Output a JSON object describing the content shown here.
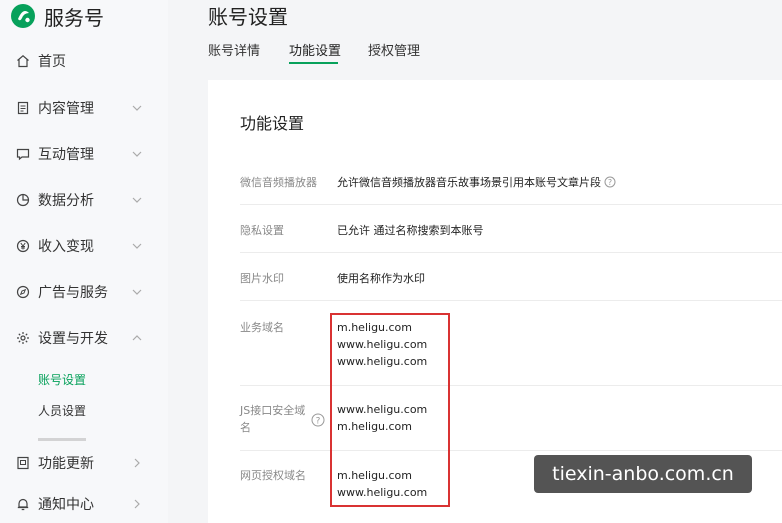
{
  "brand": {
    "name": "服务号",
    "accent": "#07a15b"
  },
  "sidebar": {
    "items": [
      {
        "label": "首页",
        "icon": "home-icon"
      },
      {
        "label": "内容管理",
        "icon": "document-icon"
      },
      {
        "label": "互动管理",
        "icon": "chat-icon"
      },
      {
        "label": "数据分析",
        "icon": "chart-pie-icon"
      },
      {
        "label": "收入变现",
        "icon": "yen-icon"
      },
      {
        "label": "广告与服务",
        "icon": "compass-icon"
      },
      {
        "label": "设置与开发",
        "icon": "gear-icon"
      },
      {
        "label": "功能更新",
        "icon": "update-icon"
      },
      {
        "label": "通知中心",
        "icon": "bell-icon"
      }
    ],
    "subitems": [
      "账号设置",
      "人员设置"
    ]
  },
  "header": {
    "title": "账号设置",
    "tabs": [
      "账号详情",
      "功能设置",
      "授权管理"
    ]
  },
  "section": {
    "title": "功能设置",
    "rows": [
      {
        "label": "微信音频播放器",
        "value": "允许微信音频播放器音乐故事场景引用本账号文章片段"
      },
      {
        "label": "隐私设置",
        "value": "已允许 通过名称搜索到本账号"
      },
      {
        "label": "图片水印",
        "value": "使用名称作为水印"
      },
      {
        "label": "业务域名",
        "values": [
          "m.heligu.com",
          "www.heligu.com",
          "www.heligu.com"
        ]
      },
      {
        "label_line1": "JS接口安全域",
        "label_line2": "名",
        "values": [
          "www.heligu.com",
          "m.heligu.com"
        ]
      },
      {
        "label": "网页授权域名",
        "values": [
          "m.heligu.com",
          "www.heligu.com"
        ]
      }
    ]
  },
  "watermark": {
    "text": "tiexin-anbo.com.cn"
  }
}
